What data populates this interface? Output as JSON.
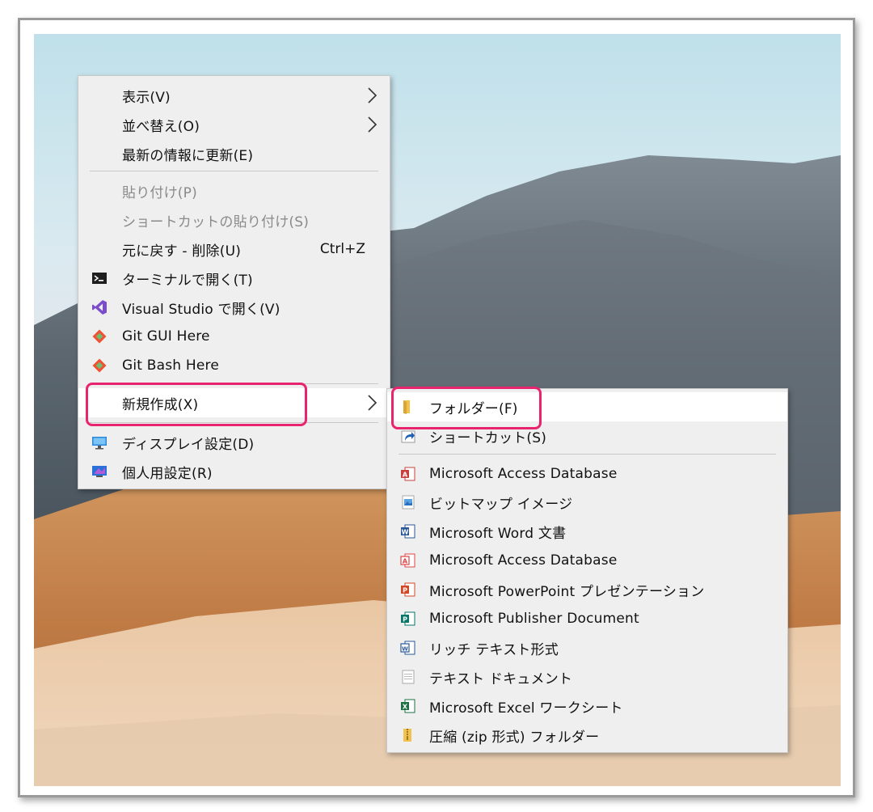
{
  "main_menu": {
    "items": [
      {
        "label": "表示(V)",
        "submenu": true
      },
      {
        "label": "並べ替え(O)",
        "submenu": true
      },
      {
        "label": "最新の情報に更新(E)"
      },
      {
        "label": "貼り付け(P)",
        "disabled": true
      },
      {
        "label": "ショートカットの貼り付け(S)",
        "disabled": true
      },
      {
        "label": "元に戻す - 削除(U)",
        "shortcut": "Ctrl+Z"
      },
      {
        "label": "ターミナルで開く(T)",
        "icon": "terminal-icon"
      },
      {
        "label": "Visual Studio で開く(V)",
        "icon": "visual-studio-icon"
      },
      {
        "label": "Git GUI Here",
        "icon": "git-icon"
      },
      {
        "label": "Git Bash Here",
        "icon": "git-icon"
      },
      {
        "label": "新規作成(X)",
        "submenu": true,
        "highlighted": true
      },
      {
        "label": "ディスプレイ設定(D)",
        "icon": "display-icon"
      },
      {
        "label": "個人用設定(R)",
        "icon": "personalize-icon"
      }
    ]
  },
  "new_submenu": {
    "items": [
      {
        "label": "フォルダー(F)",
        "icon": "folder-icon",
        "highlighted": true
      },
      {
        "label": "ショートカット(S)",
        "icon": "shortcut-icon"
      },
      {
        "label": "Microsoft Access Database",
        "icon": "access-icon"
      },
      {
        "label": "ビットマップ イメージ",
        "icon": "bitmap-icon"
      },
      {
        "label": "Microsoft Word 文書",
        "icon": "word-icon"
      },
      {
        "label": "Microsoft Access Database",
        "icon": "access-icon"
      },
      {
        "label": "Microsoft PowerPoint プレゼンテーション",
        "icon": "powerpoint-icon"
      },
      {
        "label": "Microsoft Publisher Document",
        "icon": "publisher-icon"
      },
      {
        "label": "リッチ テキスト形式",
        "icon": "rtf-icon"
      },
      {
        "label": "テキスト ドキュメント",
        "icon": "text-document-icon"
      },
      {
        "label": "Microsoft Excel ワークシート",
        "icon": "excel-icon"
      },
      {
        "label": "圧縮 (zip 形式) フォルダー",
        "icon": "zip-folder-icon"
      }
    ]
  },
  "colors": {
    "callout": "#e8246f",
    "menu_bg": "#efefef",
    "highlight_bg": "#ffffff"
  }
}
